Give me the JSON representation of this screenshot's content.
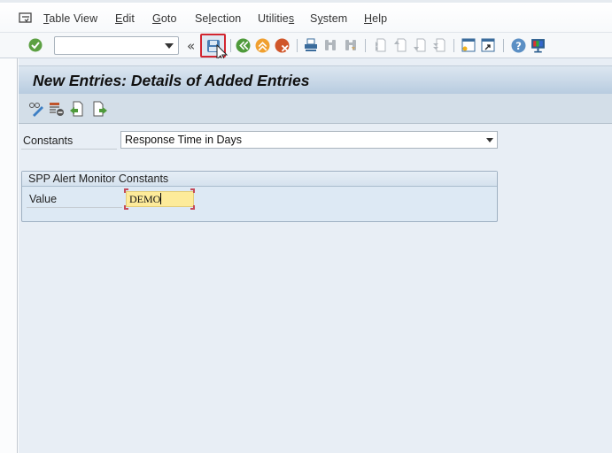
{
  "menubar": {
    "items": [
      {
        "label": "Table View",
        "mnemonic": "T"
      },
      {
        "label": "Edit",
        "mnemonic": "E"
      },
      {
        "label": "Goto",
        "mnemonic": "G"
      },
      {
        "label": "Selection",
        "mnemonic": "l"
      },
      {
        "label": "Utilities",
        "mnemonic": "s"
      },
      {
        "label": "System",
        "mnemonic": "y"
      },
      {
        "label": "Help",
        "mnemonic": "H"
      }
    ]
  },
  "toolbar": {
    "command_field_value": "",
    "icons": [
      "enter-icon",
      "save-icon",
      "back-icon",
      "exit-icon",
      "cancel-icon",
      "print-icon",
      "find-icon",
      "find-next-icon",
      "first-page-icon",
      "previous-page-icon",
      "next-page-icon",
      "last-page-icon",
      "create-session-icon",
      "create-shortcut-icon",
      "help-icon",
      "customize-layout-icon"
    ],
    "highlighted": "save-icon",
    "colors": {
      "highlight_border": "#d22630",
      "enter_green": "#5ca042",
      "back_green": "#4e9a3a",
      "exit_orange": "#f0a030",
      "cancel_red": "#d0562a"
    }
  },
  "page": {
    "title": "New Entries: Details of Added Entries",
    "app_toolbar_icons": [
      "display-change-icon",
      "delete-icon",
      "previous-entry-icon",
      "next-entry-icon"
    ]
  },
  "form": {
    "constants_label": "Constants",
    "constants_value": "Response Time in Days",
    "group_title": "SPP Alert Monitor Constants",
    "value_label": "Value",
    "value_input": "DEMO"
  }
}
